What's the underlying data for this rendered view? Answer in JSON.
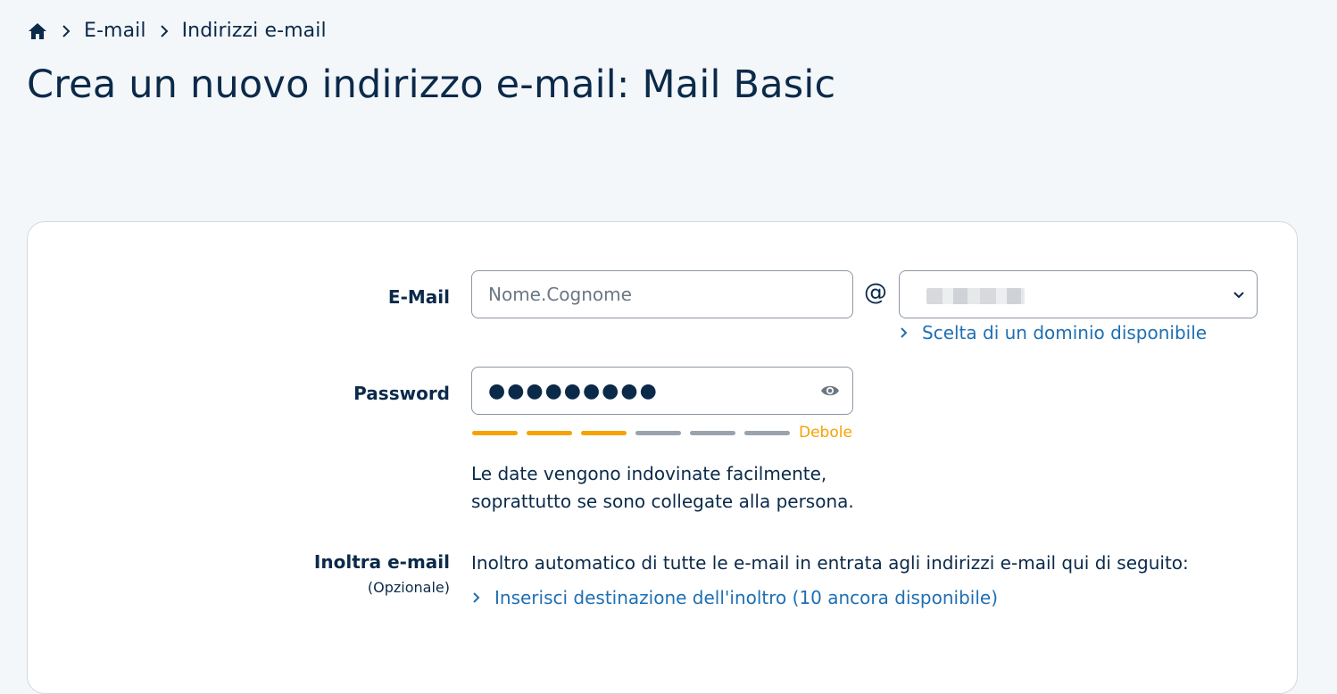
{
  "breadcrumb": {
    "items": [
      "E-mail",
      "Indirizzi e-mail"
    ]
  },
  "page": {
    "title": "Crea un nuovo indirizzo e-mail: Mail Basic"
  },
  "form": {
    "email": {
      "label": "E-Mail",
      "placeholder": "Nome.Cognome",
      "value": "",
      "at_symbol": "@",
      "domain_link": "Scelta di un dominio disponibile"
    },
    "password": {
      "label": "Password",
      "masked_value": "●●●●●●●●●",
      "strength": {
        "label": "Debole",
        "filled_segments": 3,
        "total_segments": 6,
        "color_filled": "#f5a300",
        "color_empty": "#9aa3ad"
      },
      "hint_line1": "Le date vengono indovinate facilmente,",
      "hint_line2": "soprattutto se sono collegate alla persona."
    },
    "forward": {
      "label": "Inoltra e-mail",
      "sublabel": "(Opzionale)",
      "description": "Inoltro automatico di tutte le e-mail in entrata agli indirizzi e-mail qui di seguito:",
      "link": "Inserisci destinazione dell'inoltro (10 ancora disponibile)"
    }
  },
  "colors": {
    "text": "#0b2a4a",
    "link": "#1f6fb2",
    "background": "#f4f7fa",
    "warning": "#f5a300"
  }
}
